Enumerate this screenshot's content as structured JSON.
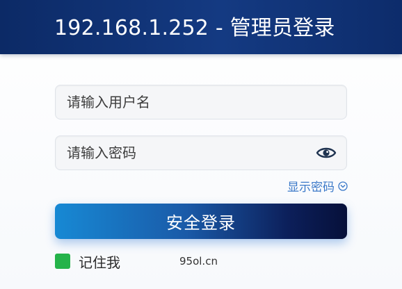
{
  "header": {
    "title": "192.168.1.252 - 管理员登录"
  },
  "form": {
    "username_placeholder": "请输入用户名",
    "password_placeholder": "请输入密码",
    "show_password_label": "显示密码",
    "login_button_label": "安全登录",
    "remember_me_label": "记住我",
    "remember_me_checked": true
  },
  "footer": {
    "watermark": "95ol.cn"
  },
  "colors": {
    "header_bg": "#0c2a66",
    "accent_link": "#3a78c8",
    "checkbox_green": "#25b34a",
    "button_start": "#1789d4",
    "button_end": "#06103a"
  },
  "icons": {
    "password_toggle": "eye-icon",
    "show_password_indicator": "chevron-circle-icon"
  }
}
